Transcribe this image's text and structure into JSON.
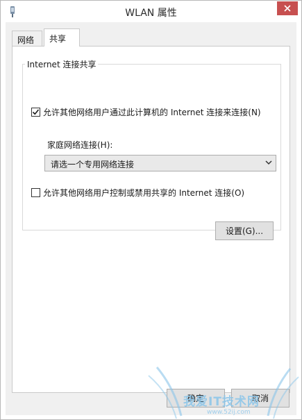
{
  "window": {
    "title": "WLAN 属性",
    "close_icon": "close-icon",
    "app_icon": "wireless-adapter-icon"
  },
  "tabs": [
    {
      "label": "网络",
      "selected": false
    },
    {
      "label": "共享",
      "selected": true
    }
  ],
  "sharing": {
    "group_label": "Internet 连接共享",
    "allow_share": {
      "label": "允许其他网络用户通过此计算机的 Internet 连接来连接(N)",
      "checked": true
    },
    "home_network": {
      "label": "家庭网络连接(H):",
      "selected": "请选一个专用网络连接"
    },
    "allow_control": {
      "label": "允许其他网络用户控制或禁用共享的 Internet 连接(O)",
      "checked": false
    },
    "settings_button": "设置(G)..."
  },
  "buttons": {
    "ok": "确定",
    "cancel": "取消"
  },
  "watermark": {
    "text": "我爱IT技术网",
    "url": "www.52ij.com"
  },
  "colors": {
    "close_button": "#c75050",
    "watermark": "#8ac5ea"
  }
}
